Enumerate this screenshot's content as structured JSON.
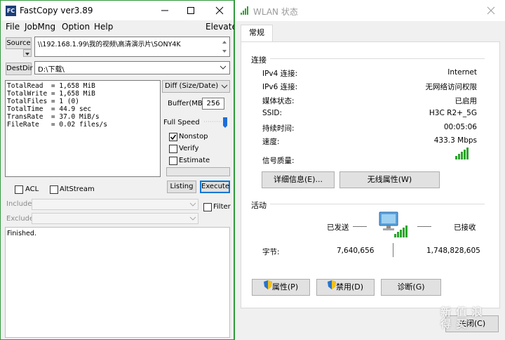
{
  "fastcopy": {
    "title": "FastCopy ver3.89",
    "menu": [
      "File",
      "JobMng",
      "Option",
      "Help"
    ],
    "elevate": "Elevate",
    "source_button": "Source",
    "source_path": "\\\\192.168.1.99\\我的视频\\高清演示片\\SONY4K",
    "destdir_button": "DestDir",
    "destdir_path": "D:\\下载\\",
    "stats": "TotalRead  = 1,658 MiB\nTotalWrite = 1,658 MiB\nTotalFiles = 1 (0)\nTotalTime  = 44.9 sec\nTransRate  = 37.0 MiB/s\nFileRate   = 0.02 files/s",
    "mode_select": "Diff (Size/Date)",
    "buffer_label": "Buffer(MB)",
    "buffer_value": "256",
    "speed_label": "Full Speed",
    "nonstop_label": "Nonstop",
    "nonstop_checked": true,
    "verify_label": "Verify",
    "verify_checked": false,
    "estimate_label": "Estimate",
    "estimate_checked": false,
    "listing_button": "Listing",
    "execute_button": "Execute",
    "acl_label": "ACL",
    "altstream_label": "AltStream",
    "include_label": "Include",
    "exclude_label": "Exclude",
    "filter_label": "Filter",
    "status_text": "Finished."
  },
  "wlan": {
    "title": "WLAN 状态",
    "tab_label": "常规",
    "connection_header": "连接",
    "rows": [
      {
        "label": "IPv4 连接:",
        "value": "Internet"
      },
      {
        "label": "IPv6 连接:",
        "value": "无网络访问权限"
      },
      {
        "label": "媒体状态:",
        "value": "已启用"
      },
      {
        "label": "SSID:",
        "value": "H3C R2+_5G"
      },
      {
        "label": "持续时间:",
        "value": "00:05:06"
      },
      {
        "label": "速度:",
        "value": "433.3 Mbps"
      }
    ],
    "signal_label": "信号质量:",
    "details_button": "详细信息(E)...",
    "wireless_button": "无线属性(W)",
    "activity_header": "活动",
    "sent_label": "已发送",
    "received_label": "已接收",
    "bytes_label": "字节:",
    "bytes_sent": "7,640,656",
    "bytes_received": "1,748,828,605",
    "properties_button": "属性(P)",
    "disable_button": "禁用(D)",
    "diagnose_button": "诊断(G)",
    "close_button": "关闭(C)",
    "accent_color": "#2f9a3a",
    "signal_color": "#2aa52a"
  },
  "watermark": "新 值 浪 得 买"
}
